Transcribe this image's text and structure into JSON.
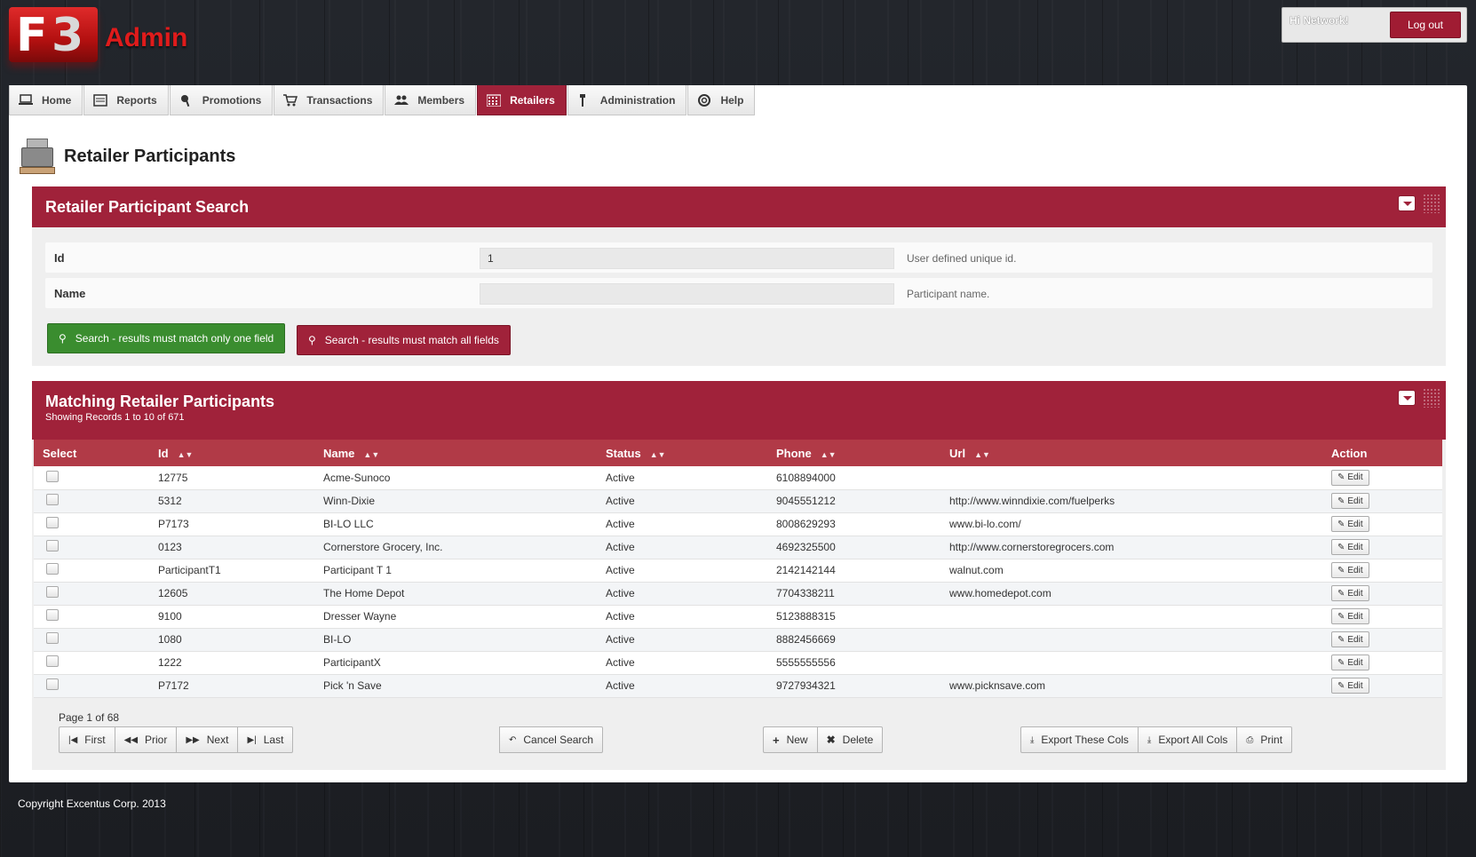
{
  "header": {
    "logo_mark_f": "F",
    "logo_mark_3": "3",
    "logo_text": "Admin",
    "greeting": "Hi Network!",
    "logout_label": "Log out"
  },
  "nav": {
    "items": [
      {
        "label": "Home",
        "icon": "monitor-icon"
      },
      {
        "label": "Reports",
        "icon": "report-icon"
      },
      {
        "label": "Promotions",
        "icon": "megaphone-icon"
      },
      {
        "label": "Transactions",
        "icon": "cart-icon"
      },
      {
        "label": "Members",
        "icon": "users-icon"
      },
      {
        "label": "Retailers",
        "icon": "building-icon",
        "active": true
      },
      {
        "label": "Administration",
        "icon": "wrench-icon"
      },
      {
        "label": "Help",
        "icon": "lifebuoy-icon"
      }
    ]
  },
  "page": {
    "title": "Retailer Participants"
  },
  "search": {
    "title": "Retailer Participant Search",
    "id_label": "Id",
    "id_value": "1",
    "id_hint": "User defined unique id.",
    "name_label": "Name",
    "name_value": "",
    "name_hint": "Participant name.",
    "search_any_label": "Search - results must match only one field",
    "search_all_label": "Search - results must match all fields"
  },
  "results": {
    "title": "Matching Retailer Participants",
    "subtitle": "Showing Records 1 to 10 of 671",
    "columns": [
      "Select",
      "Id",
      "Name",
      "Status",
      "Phone",
      "Url",
      "Action"
    ],
    "edit_label": "Edit",
    "rows": [
      {
        "id": "12775",
        "name": "Acme-Sunoco",
        "status": "Active",
        "phone": "6108894000",
        "url": ""
      },
      {
        "id": "5312",
        "name": "Winn-Dixie",
        "status": "Active",
        "phone": "9045551212",
        "url": "http://www.winndixie.com/fuelperks"
      },
      {
        "id": "P7173",
        "name": "BI-LO LLC",
        "status": "Active",
        "phone": "8008629293",
        "url": "www.bi-lo.com/"
      },
      {
        "id": "0123",
        "name": "Cornerstore Grocery, Inc.",
        "status": "Active",
        "phone": "4692325500",
        "url": "http://www.cornerstoregrocers.com"
      },
      {
        "id": "ParticipantT1",
        "name": "Participant T 1",
        "status": "Active",
        "phone": "2142142144",
        "url": "walnut.com"
      },
      {
        "id": "12605",
        "name": "The Home Depot",
        "status": "Active",
        "phone": "7704338211",
        "url": "www.homedepot.com"
      },
      {
        "id": "9100",
        "name": "Dresser Wayne",
        "status": "Active",
        "phone": "5123888315",
        "url": ""
      },
      {
        "id": "1080",
        "name": "BI-LO",
        "status": "Active",
        "phone": "8882456669",
        "url": ""
      },
      {
        "id": "1222",
        "name": "ParticipantX",
        "status": "Active",
        "phone": "5555555556",
        "url": ""
      },
      {
        "id": "P7172",
        "name": "Pick 'n Save",
        "status": "Active",
        "phone": "9727934321",
        "url": "www.picknsave.com"
      }
    ],
    "page_info": "Page 1 of 68",
    "pager": {
      "first": "First",
      "prior": "Prior",
      "next": "Next",
      "last": "Last"
    },
    "cancel_search": "Cancel Search",
    "new_label": "New",
    "delete_label": "Delete",
    "export_these": "Export These Cols",
    "export_all": "Export All Cols",
    "print_label": "Print"
  },
  "footer": {
    "copyright": "Copyright Excentus Corp. 2013"
  },
  "colors": {
    "accent": "#a0223a",
    "table_header": "#b13a47",
    "search_green": "#3a8d2f"
  }
}
